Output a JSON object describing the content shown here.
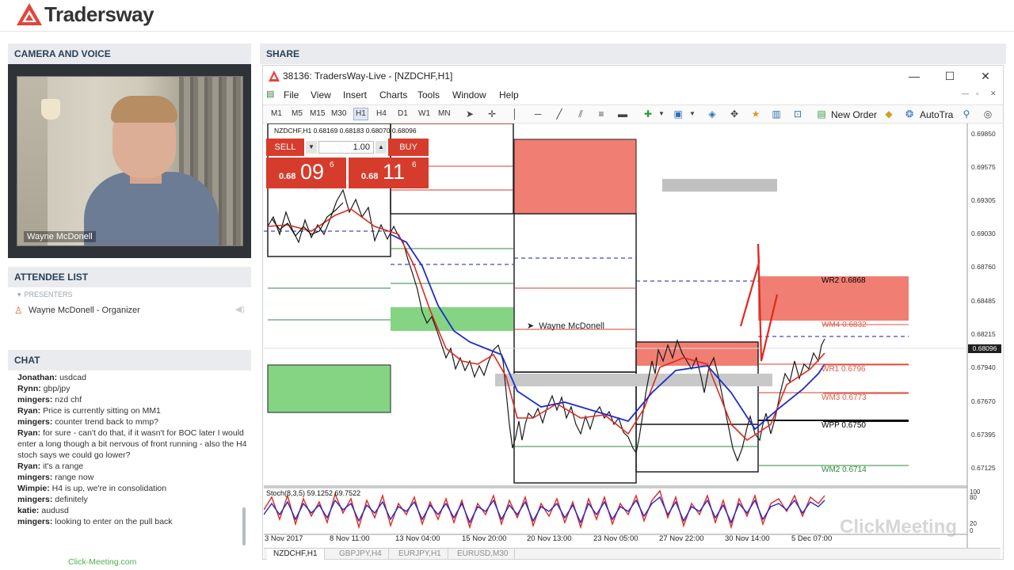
{
  "header": {
    "logo_text": "Tradersway"
  },
  "camera": {
    "title": "CAMERA AND VOICE",
    "participant_name": "Wayne McDonell"
  },
  "attendees": {
    "title": "ATTENDEE LIST",
    "presenters_label": "PRESENTERS",
    "items": [
      {
        "label": "Wayne McDonell - Organizer"
      }
    ]
  },
  "chat": {
    "title": "CHAT",
    "messages": [
      {
        "author": "Jonathan:",
        "text": " usdcad"
      },
      {
        "author": "Rynn:",
        "text": " gbp/jpy"
      },
      {
        "author": "mingers:",
        "text": " nzd chf"
      },
      {
        "author": "Ryan:",
        "text": " Price is currently sitting on MM1"
      },
      {
        "author": "mingers:",
        "text": " counter trend back to mmp?"
      },
      {
        "author": "Ryan:",
        "text": " for sure - can't do that, if it wasn't for BOC later I would enter a long though a bit nervous of front running - also the H4 stoch says we could go lower?"
      },
      {
        "author": "Ryan:",
        "text": " it's a range"
      },
      {
        "author": "mingers:",
        "text": " range now"
      },
      {
        "author": "Wimpie:",
        "text": " H4 is up, we're in consolidation"
      },
      {
        "author": "mingers:",
        "text": " definitely"
      },
      {
        "author": "katie:",
        "text": " audusd"
      },
      {
        "author": "mingers:",
        "text": " looking to enter on the pull back"
      }
    ]
  },
  "footer": {
    "link": "Click-Meeting.com"
  },
  "share": {
    "title": "SHARE",
    "window_title": "38136: TradersWay-Live - [NZDCHF,H1]",
    "menu": [
      "File",
      "View",
      "Insert",
      "Charts",
      "Tools",
      "Window",
      "Help"
    ],
    "timeframes": [
      "M1",
      "M5",
      "M15",
      "M30",
      "H1",
      "H4",
      "D1",
      "W1",
      "MN"
    ],
    "active_timeframe": "H1",
    "toolbar": {
      "new_order": "New Order",
      "autotrade": "AutoTra"
    },
    "symbol_info": "NZDCHF,H1  0.68169 0.68183 0.68070 0.68096",
    "trade": {
      "sell_label": "SELL",
      "buy_label": "BUY",
      "lot": "1.00",
      "sell_small": "0.68",
      "sell_big": "09",
      "sell_sup": "6",
      "buy_small": "0.68",
      "buy_big": "11",
      "buy_sup": "6"
    },
    "cursor_label": "Wayne McDonell",
    "stoch_label": "Stoch(8,3,5) 59.1252 69.7522",
    "price_axis": [
      "0.69850",
      "0.69575",
      "0.69305",
      "0.69030",
      "0.68760",
      "0.68485",
      "0.68215",
      "0.67940",
      "0.67670",
      "0.67395",
      "0.67125"
    ],
    "current_price": "0.68096",
    "stoch_axis": [
      "100",
      "80",
      "20",
      "0"
    ],
    "date_axis": [
      "3 Nov 2017",
      "8 Nov 11:00",
      "13 Nov 04:00",
      "15 Nov 20:00",
      "20 Nov 13:00",
      "23 Nov 05:00",
      "27 Nov 22:00",
      "30 Nov 14:00",
      "5 Dec 07:00"
    ],
    "levels": [
      {
        "label": "WR2 0.6868",
        "color": "#222222"
      },
      {
        "label": "WM4 0.6832",
        "color": "#e05a4a"
      },
      {
        "label": "WR1 0.6796",
        "color": "#e05a4a"
      },
      {
        "label": "WM3 0.6773",
        "color": "#e05a4a"
      },
      {
        "label": "WPP 0.6750",
        "color": "#222222"
      },
      {
        "label": "WM2 0.6714",
        "color": "#2e8b3a"
      }
    ],
    "sheet_tabs": [
      "NZDCHF,H1",
      "GBPJPY,H4",
      "EURJPY,H1",
      "EURUSD,M30"
    ],
    "watermark": "ClickMeeting"
  },
  "colors": {
    "accent_red": "#d63c2c",
    "zone_red": "#f07b6e",
    "zone_green": "#7fd27f",
    "header_text": "#2a3f58"
  },
  "icons": [
    "tradersway-logo-icon",
    "mt4-app-icon",
    "organizer-icon",
    "speaker-icon"
  ]
}
